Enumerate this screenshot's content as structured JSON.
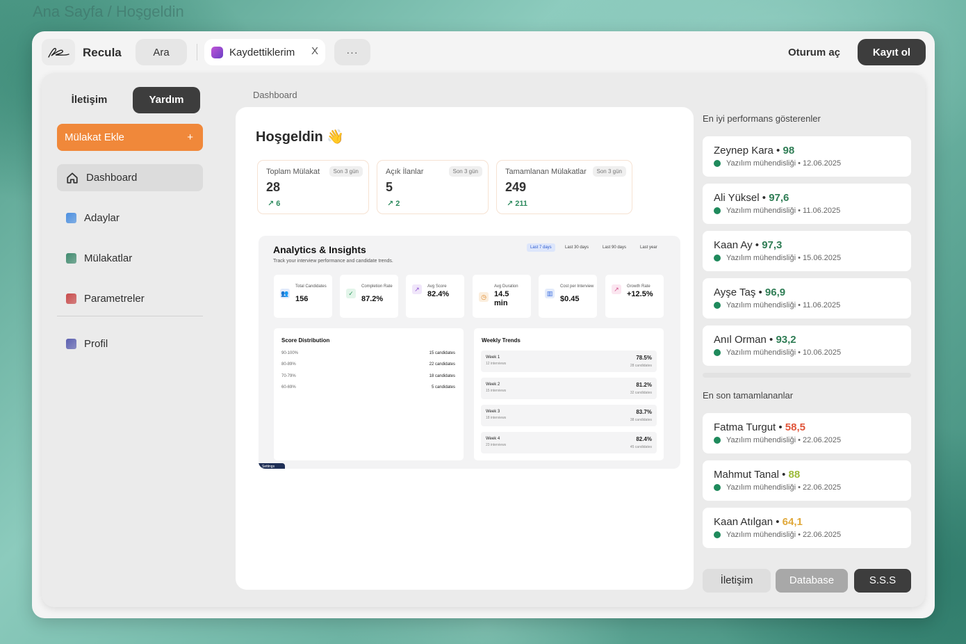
{
  "page": {
    "breadcrumb": "Ana Sayfa / Hoşgeldin"
  },
  "topbar": {
    "brand": "Recula",
    "search_label": "Ara",
    "tab_label": "Kaydettiklerim",
    "tab_close": "X",
    "more_label": "···",
    "login_label": "Oturum aç",
    "register_label": "Kayıt ol"
  },
  "sidebar": {
    "tabs": [
      {
        "label": "İletişim"
      },
      {
        "label": "Yardım"
      }
    ],
    "add_button": {
      "label": "Mülakat Ekle",
      "icon": "+"
    },
    "items": [
      {
        "label": "Dashboard",
        "icon": "home-icon"
      },
      {
        "label": "Adaylar",
        "color": "#4b8fe0"
      },
      {
        "label": "Mülakatlar",
        "color": "#3f8a6e"
      },
      {
        "label": "Parametreler",
        "color": "#c84a4a"
      },
      {
        "label": "Profil",
        "color": "#5b5fb0"
      }
    ]
  },
  "main": {
    "crumb": "Dashboard",
    "welcome": "Hoşgeldin",
    "welcome_emoji": "👋",
    "stats": [
      {
        "label": "Toplam Mülakat",
        "badge": "Son 3 gün",
        "value": "28",
        "delta": "↗ 6"
      },
      {
        "label": "Açık İlanlar",
        "badge": "Son 3 gün",
        "value": "5",
        "delta": "↗ 2"
      },
      {
        "label": "Tamamlanan Mülakatlar",
        "badge": "Son 3 gün",
        "value": "249",
        "delta": "↗ 211"
      }
    ],
    "analytics": {
      "title": "Analytics & Insights",
      "subtitle": "Track your interview performance and candidate trends.",
      "ranges": [
        "Last 7 days",
        "Last 30 days",
        "Last 90 days",
        "Last year"
      ],
      "metrics": [
        {
          "label": "Total Candidates",
          "value": "156",
          "icon": "users-icon",
          "color": "#3d6fe0"
        },
        {
          "label": "Completion Rate",
          "value": "87.2%",
          "icon": "check-circle-icon",
          "color": "#2d9a5e"
        },
        {
          "label": "Avg Score",
          "value": "82.4%",
          "icon": "trending-up-icon",
          "color": "#8a4fd0"
        },
        {
          "label": "Avg Duration",
          "value": "14.5 min",
          "icon": "clock-icon",
          "color": "#e08a2d"
        },
        {
          "label": "Cost per Interview",
          "value": "$0.45",
          "icon": "bar-chart-icon",
          "color": "#3d6fe0"
        },
        {
          "label": "Growth Rate",
          "value": "+12.5%",
          "icon": "trending-up-icon",
          "color": "#d04f8a"
        }
      ],
      "score_distribution": {
        "title": "Score Distribution",
        "rows": [
          {
            "range": "90-100%",
            "count": "15 candidates"
          },
          {
            "range": "80-89%",
            "count": "22 candidates"
          },
          {
            "range": "70-79%",
            "count": "18 candidates"
          },
          {
            "range": "60-69%",
            "count": "5 candidates"
          }
        ]
      },
      "weekly_trends": {
        "title": "Weekly Trends",
        "weeks": [
          {
            "name": "Week 1",
            "interviews": "12 interviews",
            "rate": "78.5%",
            "candidates": "28 candidates"
          },
          {
            "name": "Week 2",
            "interviews": "15 interviews",
            "rate": "81.2%",
            "candidates": "32 candidates"
          },
          {
            "name": "Week 3",
            "interviews": "18 interviews",
            "rate": "83.7%",
            "candidates": "38 candidates"
          },
          {
            "name": "Week 4",
            "interviews": "23 interviews",
            "rate": "82.4%",
            "candidates": "45 candidates"
          }
        ]
      },
      "tag": "Settings"
    }
  },
  "right": {
    "top_title": "En iyi performans gösterenler",
    "top_performers": [
      {
        "name": "Zeynep Kara",
        "score": "98",
        "score_color": "#2f7d55",
        "role": "Yazılım mühendisliği",
        "date": "12.06.2025"
      },
      {
        "name": "Ali Yüksel",
        "score": "97,6",
        "score_color": "#2f7d55",
        "role": "Yazılım mühendisliği",
        "date": "11.06.2025"
      },
      {
        "name": "Kaan Ay",
        "score": "97,3",
        "score_color": "#2f7d55",
        "role": "Yazılım mühendisliği",
        "date": "15.06.2025"
      },
      {
        "name": "Ayşe Taş",
        "score": "96,9",
        "score_color": "#2f7d55",
        "role": "Yazılım mühendisliği",
        "date": "11.06.2025"
      },
      {
        "name": "Anıl Orman",
        "score": "93,2",
        "score_color": "#2f7d55",
        "role": "Yazılım mühendisliği",
        "date": "10.06.2025"
      }
    ],
    "recent_title": "En son tamamlananlar",
    "recent": [
      {
        "name": "Fatma Turgut",
        "score": "58,5",
        "score_color": "#e0553a",
        "role": "Yazılım mühendisliği",
        "date": "22.06.2025"
      },
      {
        "name": "Mahmut Tanal",
        "score": "88",
        "score_color": "#9cbb3a",
        "role": "Yazılım mühendisliği",
        "date": "22.06.2025"
      },
      {
        "name": "Kaan Atılgan",
        "score": "64,1",
        "score_color": "#e0a83a",
        "role": "Yazılım mühendisliği",
        "date": "22.06.2025"
      }
    ],
    "footer_buttons": [
      {
        "label": "İletişim"
      },
      {
        "label": "Database"
      },
      {
        "label": "S.S.S"
      }
    ]
  }
}
